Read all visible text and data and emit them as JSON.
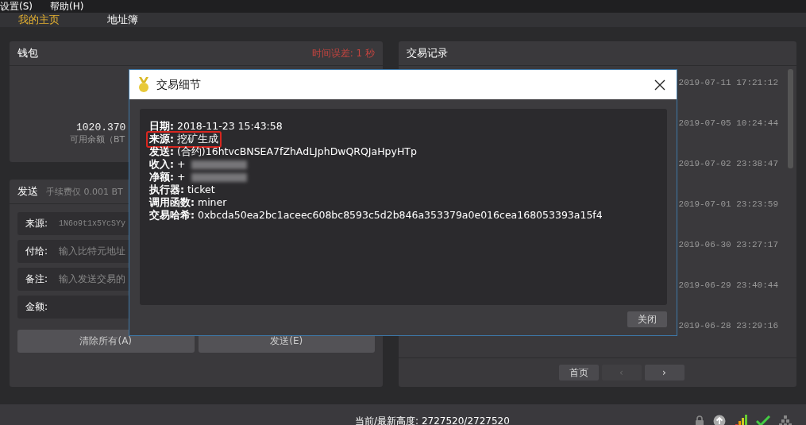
{
  "menu": [
    "设置(S)",
    "帮助(H)"
  ],
  "tabs": [
    {
      "label": "我的主页",
      "selected": true
    },
    {
      "label": "地址簿",
      "selected": false
    }
  ],
  "wallet": {
    "title": "钱包",
    "time_offset": "时间误差: 1 秒",
    "balance": "1020.370",
    "balance_label": "可用余额（BT"
  },
  "send": {
    "title": "发送",
    "fee_note": "手续费仅 0.001 BT",
    "fields": [
      {
        "label": "来源:",
        "value": "1N6o9t1x5YcSYy"
      },
      {
        "label": "付给:",
        "placeholder": "输入比特元地址"
      },
      {
        "label": "备注:",
        "placeholder": "输入发送交易的"
      },
      {
        "label": "金额:"
      }
    ],
    "buttons": [
      "清除所有(A)",
      "发送(E)"
    ]
  },
  "transactions": {
    "title": "交易记录",
    "rows": [
      "2019-07-11 17:21:12",
      "2019-07-05 10:24:44",
      "2019-07-02 23:38:47",
      "2019-07-01 23:23:59",
      "2019-06-30 23:27:17",
      "2019-06-29 23:40:44",
      "2019-06-28 23:29:16"
    ],
    "pager": [
      {
        "label": "首页",
        "disabled": false
      },
      {
        "label": "‹",
        "disabled": true
      },
      {
        "label": "›",
        "disabled": false
      }
    ]
  },
  "dialog": {
    "title": "交易细节",
    "fields": [
      {
        "label": "日期:",
        "value": "2018-11-23 15:43:58",
        "highlighted": false,
        "redacted": false
      },
      {
        "label": "来源:",
        "value": "挖矿生成",
        "highlighted": true,
        "redacted": false
      },
      {
        "label": "发送:",
        "value": "(合约)16htvcBNSEA7fZhAdLJphDwQRQJaHpyHTp",
        "highlighted": false,
        "redacted": false
      },
      {
        "label": "收入:",
        "value": "+",
        "highlighted": false,
        "redacted": true
      },
      {
        "label": "净额:",
        "value": "+",
        "highlighted": false,
        "redacted": true
      },
      {
        "label": "执行器:",
        "value": "ticket",
        "highlighted": false,
        "redacted": false
      },
      {
        "label": "调用函数:",
        "value": "miner",
        "highlighted": false,
        "redacted": false
      },
      {
        "label": "交易哈希:",
        "value": "0xbcda50ea2bc1aceec608bc8593c5d2b846a353379a0e016cea168053393a15f4",
        "highlighted": false,
        "redacted": false
      }
    ],
    "close_button": "关闭"
  },
  "status_bar": {
    "height_label": "当前/最新高度:",
    "height_value": "2727520/2727520"
  }
}
